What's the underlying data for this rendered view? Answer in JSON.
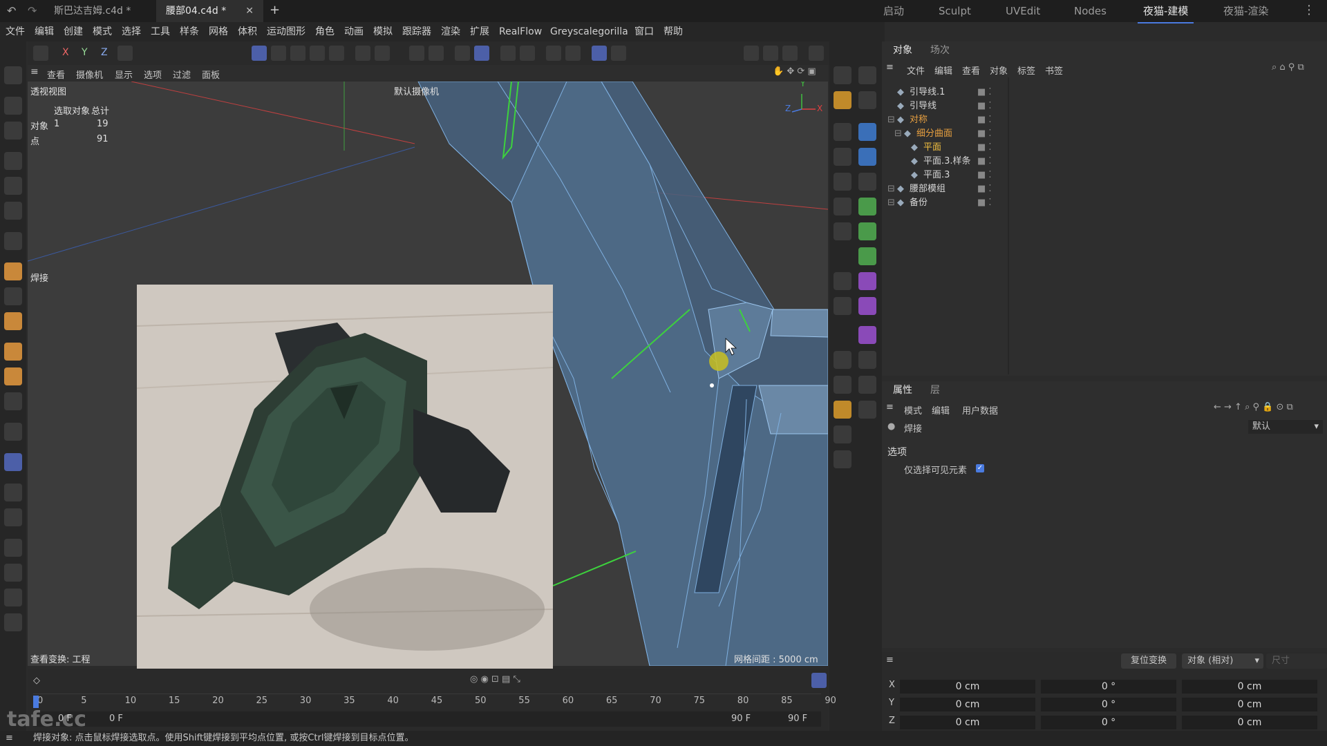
{
  "titlebar": {
    "tabs": [
      {
        "label": "斯巴达吉姆.c4d *",
        "active": false
      },
      {
        "label": "腰部04.c4d *",
        "active": true
      }
    ],
    "add_tab": "+",
    "layouts": [
      "启动",
      "Sculpt",
      "UVEdit",
      "Nodes",
      "夜猫-建模",
      "夜猫-渲染"
    ],
    "active_layout": "夜猫-建模"
  },
  "menubar": [
    "文件",
    "编辑",
    "创建",
    "模式",
    "选择",
    "工具",
    "样条",
    "网格",
    "体积",
    "运动图形",
    "角色",
    "动画",
    "模拟",
    "跟踪器",
    "渲染",
    "扩展",
    "RealFlow",
    "Greyscalegorilla",
    "窗口",
    "帮助"
  ],
  "axis_toggles": [
    "X",
    "Y",
    "Z"
  ],
  "viewport": {
    "menu": [
      "查看",
      "摄像机",
      "显示",
      "选项",
      "过滤",
      "面板"
    ],
    "name": "透视视图",
    "camera": "默认摄像机",
    "stats": {
      "header_sel": "选取对象",
      "header_total": "总计",
      "rows": [
        {
          "label": "对象",
          "sel": "1",
          "total": "19"
        },
        {
          "label": "点",
          "sel": "",
          "total": "91"
        }
      ]
    },
    "tool_label": "焊接",
    "view_transform": "查看变换: 工程",
    "grid_spacing": "网格间距 : 5000 cm",
    "axis": {
      "x": "X",
      "y": "Y",
      "z": "Z"
    }
  },
  "object_manager": {
    "tabs": [
      "对象",
      "场次"
    ],
    "menu": [
      "文件",
      "编辑",
      "查看",
      "对象",
      "标签",
      "书签"
    ],
    "objects": [
      {
        "name": "引导线.1",
        "indent": 0,
        "color": "#d6d6d6"
      },
      {
        "name": "引导线",
        "indent": 0,
        "color": "#d6d6d6"
      },
      {
        "name": "对称",
        "indent": 0,
        "color": "#e8a040"
      },
      {
        "name": "细分曲面",
        "indent": 1,
        "color": "#e8a040"
      },
      {
        "name": "平面",
        "indent": 2,
        "color": "#f2c040"
      },
      {
        "name": "平面.3.样条",
        "indent": 2,
        "color": "#d6d6d6"
      },
      {
        "name": "平面.3",
        "indent": 2,
        "color": "#d6d6d6"
      },
      {
        "name": "腰部模组",
        "indent": 0,
        "color": "#d6d6d6"
      },
      {
        "name": "备份",
        "indent": 0,
        "color": "#d6d6d6"
      }
    ]
  },
  "attributes": {
    "tabs": [
      "属性",
      "层"
    ],
    "menu": [
      "模式",
      "编辑",
      "用户数据"
    ],
    "tool_name": "焊接",
    "preset": "默认",
    "section": "选项",
    "option_label": "仅选择可见元素",
    "option_checked": true
  },
  "coords": {
    "reset_button": "复位变换",
    "mode": "对象 (相对)",
    "size_label": "尺寸",
    "rows": [
      {
        "axis": "X",
        "pos": "0 cm",
        "rot": "0 °",
        "size": "0 cm"
      },
      {
        "axis": "Y",
        "pos": "0 cm",
        "rot": "0 °",
        "size": "0 cm"
      },
      {
        "axis": "Z",
        "pos": "0 cm",
        "rot": "0 °",
        "size": "0 cm"
      }
    ]
  },
  "timeline": {
    "ticks": [
      "0",
      "5",
      "10",
      "15",
      "20",
      "25",
      "30",
      "35",
      "40",
      "45",
      "50",
      "55",
      "60",
      "65",
      "70",
      "75",
      "80",
      "85",
      "90"
    ],
    "start_frame": "0 F",
    "current_frame": "0 F",
    "end_frame": "90 F",
    "end_frame2": "90 F"
  },
  "status": {
    "message": "焊接对象: 点击鼠标焊接选取点。使用Shift键焊接到平均点位置, 或按Ctrl键焊接到目标点位置。"
  },
  "watermark": "tafe.cc",
  "colors": {
    "accent": "#4a7be0",
    "mesh_face": "#4f6f8f",
    "mesh_edge": "#7fb0e0",
    "selected_edge": "#3dd23d",
    "orange_object": "#e8a040"
  }
}
